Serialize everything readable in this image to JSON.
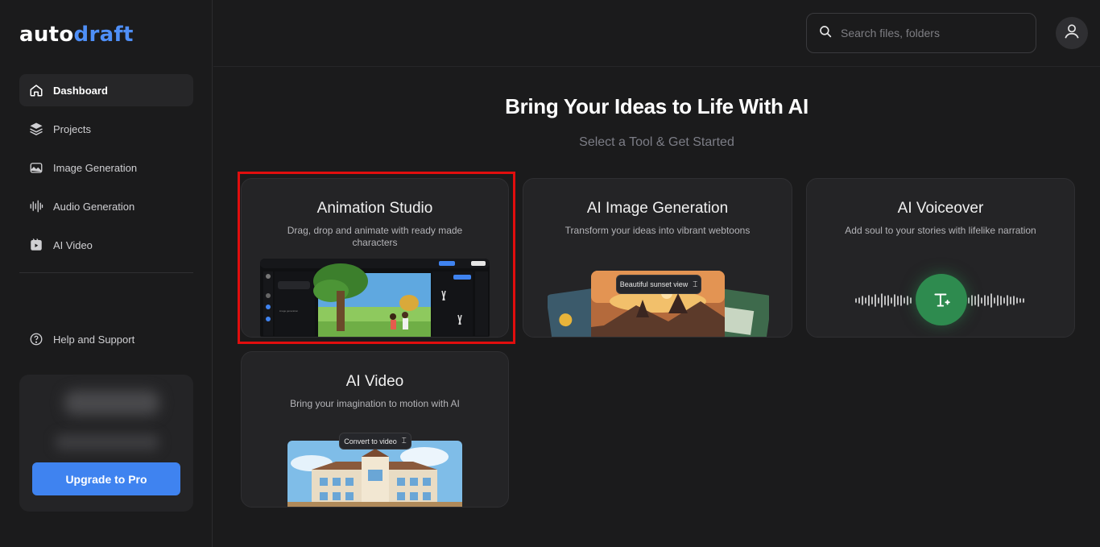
{
  "brand": {
    "part1": "auto",
    "part2": "draft"
  },
  "sidebar": {
    "items": [
      {
        "label": "Dashboard",
        "icon": "home-icon"
      },
      {
        "label": "Projects",
        "icon": "layers-icon"
      },
      {
        "label": "Image Generation",
        "icon": "image-ai-icon"
      },
      {
        "label": "Audio Generation",
        "icon": "audio-wave-icon"
      },
      {
        "label": "AI Video",
        "icon": "video-icon"
      }
    ],
    "help": "Help and Support",
    "upgrade": "Upgrade to Pro"
  },
  "search": {
    "placeholder": "Search files, folders"
  },
  "main": {
    "title": "Bring Your Ideas to Life With AI",
    "subtitle": "Select a Tool & Get Started",
    "cards": [
      {
        "title": "Animation Studio",
        "desc": "Drag, drop and animate with ready made characters"
      },
      {
        "title": "AI Image Generation",
        "desc": "Transform your ideas into vibrant webtoons",
        "tooltip": "Beautiful sunset view"
      },
      {
        "title": "AI Voiceover",
        "desc": "Add soul to your stories with lifelike narration"
      },
      {
        "title": "AI Video",
        "desc": "Bring your imagination to motion with AI",
        "tooltip": "Convert to video"
      }
    ]
  },
  "colors": {
    "accent": "#3f83f0",
    "highlight": "#e10e0e",
    "voice_green": "#2e8b4f"
  }
}
